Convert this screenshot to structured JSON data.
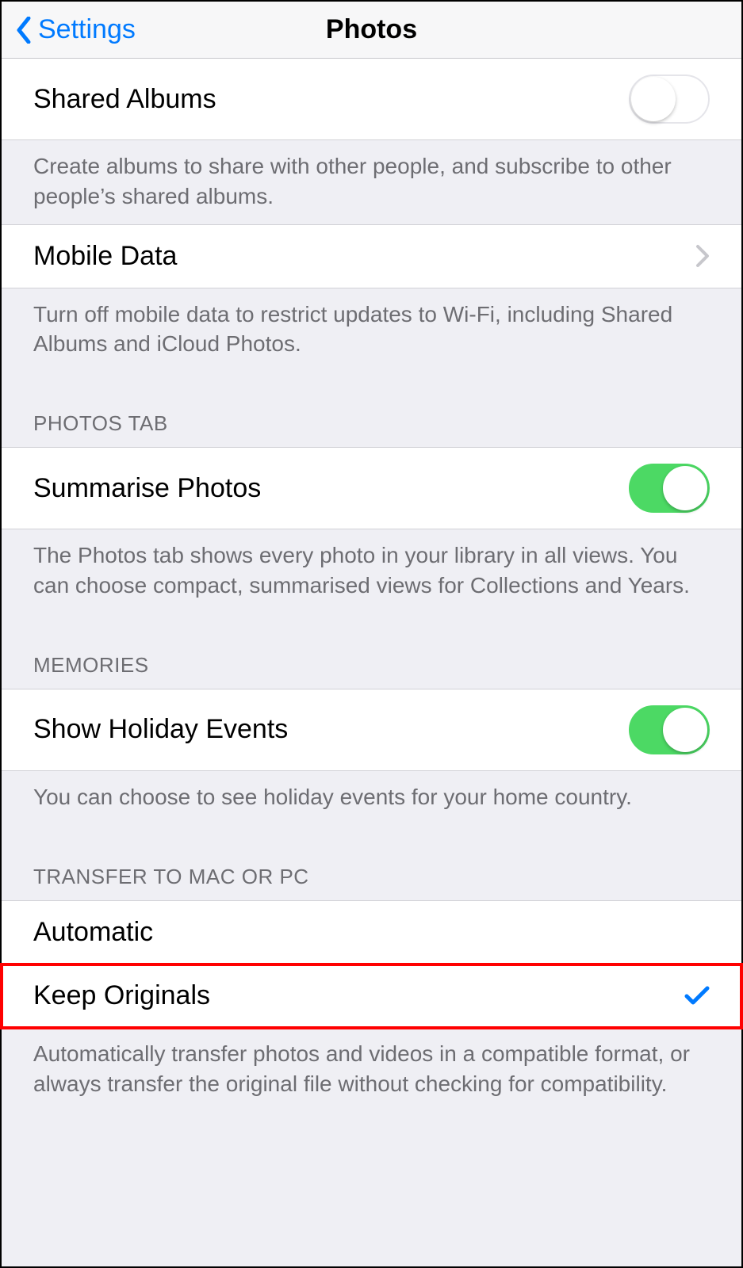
{
  "navbar": {
    "back_label": "Settings",
    "title": "Photos"
  },
  "groups": {
    "shared_albums": {
      "label": "Shared Albums",
      "toggle_on": false,
      "footer": "Create albums to share with other people, and subscribe to other people’s shared albums."
    },
    "mobile_data": {
      "label": "Mobile Data",
      "footer": "Turn off mobile data to restrict updates to Wi-Fi, including Shared Albums and iCloud Photos."
    },
    "photos_tab": {
      "header": "PHOTOS TAB",
      "summarise_label": "Summarise Photos",
      "summarise_on": true,
      "footer": "The Photos tab shows every photo in your library in all views. You can choose compact, summarised views for Collections and Years."
    },
    "memories": {
      "header": "MEMORIES",
      "holiday_label": "Show Holiday Events",
      "holiday_on": true,
      "footer": "You can choose to see holiday events for your home country."
    },
    "transfer": {
      "header": "TRANSFER TO MAC OR PC",
      "options": {
        "automatic": {
          "label": "Automatic",
          "selected": false
        },
        "keep_originals": {
          "label": "Keep Originals",
          "selected": true
        }
      },
      "footer": "Automatically transfer photos and videos in a compatible format, or always transfer the original file without checking for compatibility."
    }
  }
}
